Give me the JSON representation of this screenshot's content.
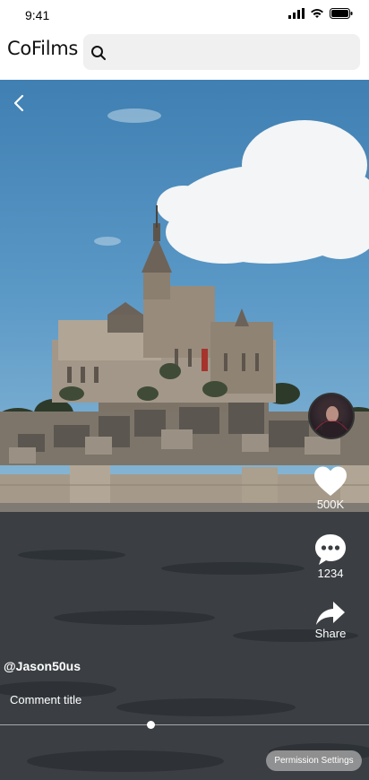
{
  "status_bar": {
    "time": "9:41"
  },
  "header": {
    "app_title": "CoFilms",
    "search_placeholder": ""
  },
  "video": {
    "likes_count": "500K",
    "comments_count": "1234",
    "share_label": "Share",
    "username": "@Jason50us",
    "comment_title": "Comment title",
    "progress": 0.41,
    "permission_label": "Permission Settings"
  },
  "icons": {
    "back": "chevron-left-icon",
    "search": "search-icon",
    "like": "heart-icon",
    "comment": "comment-bubble-icon",
    "share": "share-arrow-icon"
  },
  "colors": {
    "accent": "#ffffff",
    "header_bg": "#ffffff",
    "search_bg": "#f0f0f0"
  }
}
